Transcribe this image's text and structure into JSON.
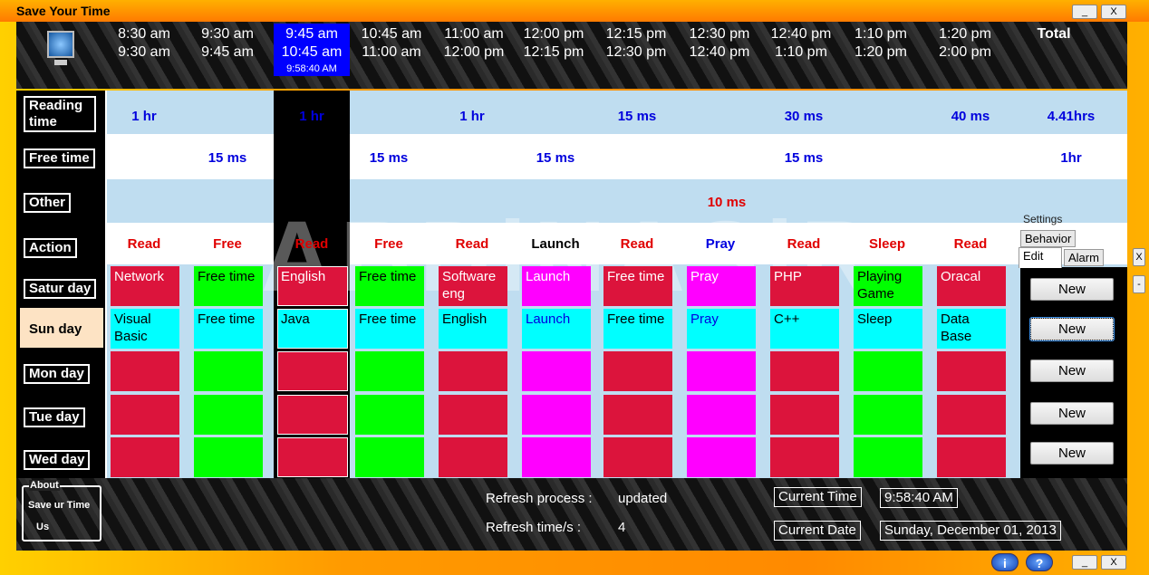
{
  "window": {
    "title": "Save Your Time",
    "minimize": "_",
    "close": "X",
    "bottom_minimize": "_",
    "bottom_close": "X"
  },
  "colors": {
    "red": "#DC143C",
    "green": "#00FF00",
    "magenta": "#FF00FF",
    "cyan": "#00FFFF",
    "current_slot": "#0000FF",
    "band": "#BFDDF0"
  },
  "header": {
    "icon": "monitor-icon",
    "slots": [
      {
        "start": "8:30 am",
        "end": "9:30 am"
      },
      {
        "start": "9:30 am",
        "end": "9:45 am"
      },
      {
        "start": "9:45 am",
        "end": "10:45 am",
        "clock": "9:58:40 AM"
      },
      {
        "start": "10:45 am",
        "end": "11:00 am"
      },
      {
        "start": "11:00 am",
        "end": "12:00 pm"
      },
      {
        "start": "12:00 pm",
        "end": "12:15 pm"
      },
      {
        "start": "12:15 pm",
        "end": "12:30 pm"
      },
      {
        "start": "12:30 pm",
        "end": "12:40 pm"
      },
      {
        "start": "12:40 pm",
        "end": "1:10 pm"
      },
      {
        "start": "1:10 pm",
        "end": "1:20 pm"
      },
      {
        "start": "1:20 pm",
        "end": "2:00 pm"
      }
    ],
    "total": "Total"
  },
  "rows": {
    "reading": "Reading time",
    "free": "Free time",
    "other": "Other",
    "action": "Action",
    "days": [
      "Satur day",
      "Sun day",
      "Mon day",
      "Tue day",
      "Wed day"
    ]
  },
  "reading_values": [
    {
      "col": 0,
      "v": "1 hr"
    },
    {
      "col": 2,
      "v": "1 hr"
    },
    {
      "col": 4,
      "v": "1 hr"
    },
    {
      "col": 6,
      "v": "15 ms"
    },
    {
      "col": 8,
      "v": "30 ms"
    },
    {
      "col": 10,
      "v": "40 ms"
    },
    {
      "col": 11,
      "v": "4.41hrs"
    }
  ],
  "free_values": [
    {
      "col": 1,
      "v": "15 ms"
    },
    {
      "col": 3,
      "v": "15 ms"
    },
    {
      "col": 5,
      "v": "15 ms"
    },
    {
      "col": 8,
      "v": "15 ms"
    },
    {
      "col": 11,
      "v": "1hr"
    }
  ],
  "other_value": "10 ms",
  "actions": [
    {
      "v": "Read",
      "c": "#e00000"
    },
    {
      "v": "Free",
      "c": "#e00000"
    },
    {
      "v": "Read",
      "c": "#e00000"
    },
    {
      "v": "Free",
      "c": "#e00000"
    },
    {
      "v": "Read",
      "c": "#e00000"
    },
    {
      "v": "Launch",
      "c": "#000"
    },
    {
      "v": "Read",
      "c": "#e00000"
    },
    {
      "v": "Pray",
      "c": "#0000e0"
    },
    {
      "v": "Read",
      "c": "#e00000"
    },
    {
      "v": "Sleep",
      "c": "#e00000"
    },
    {
      "v": "Read",
      "c": "#e00000"
    }
  ],
  "pattern": [
    "red",
    "green",
    "red",
    "green",
    "red",
    "magenta",
    "red",
    "magenta",
    "red",
    "green",
    "red"
  ],
  "saturday": [
    "Network",
    "Free time",
    "English",
    "Free time",
    "Software eng",
    "Launch",
    "Free time",
    "Pray",
    "PHP",
    "Playing Game",
    "Oracal"
  ],
  "sunday": [
    "Visual Basic",
    "Free time",
    "Java",
    "Free time",
    "English",
    "Launch",
    "Free time",
    "Pray",
    "C++",
    "Sleep",
    "Data Base"
  ],
  "settings": {
    "label": "Settings",
    "tabs": [
      "Behavior",
      "Edit",
      "Alarm"
    ],
    "active_tab": "Edit",
    "buttons": [
      "New",
      "New",
      "New",
      "New",
      "New"
    ],
    "side_close": "X",
    "side_min": "-"
  },
  "about": {
    "label": "About",
    "line1": "Save ur Time",
    "line2": "Us"
  },
  "status": {
    "refresh_label": "Refresh process :",
    "refresh_value": "updated",
    "interval_label": "Refresh time/s :",
    "interval_value": "4",
    "time_label": "Current Time",
    "time_value": "9:58:40 AM",
    "date_label": "Current Date",
    "date_value": "Sunday, December 01, 2013"
  },
  "watermark": "ABDiNASiR",
  "bottom_icons": {
    "info": "i",
    "help": "?"
  }
}
